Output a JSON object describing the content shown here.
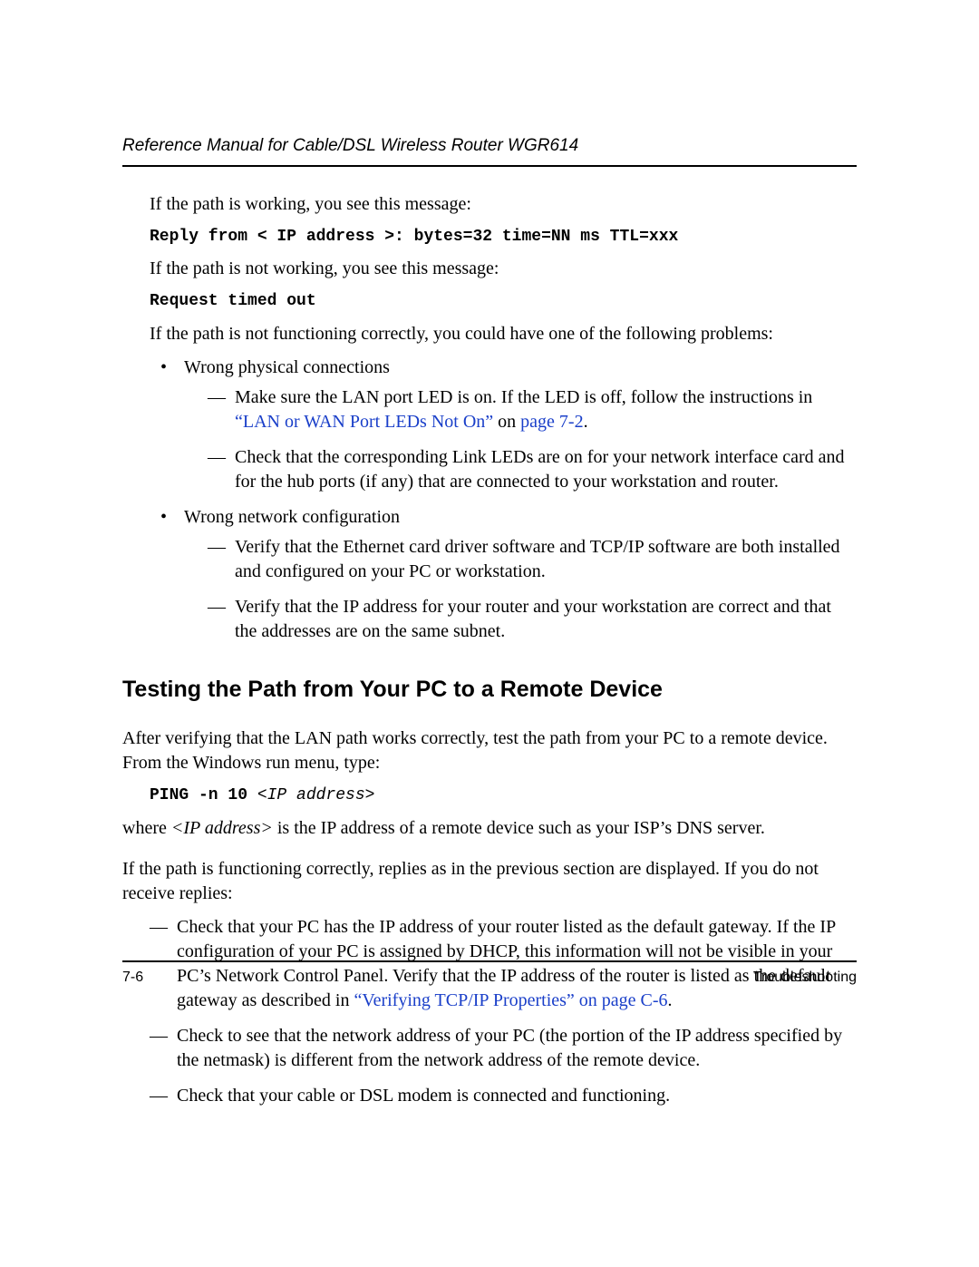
{
  "header": {
    "running_title": "Reference Manual for Cable/DSL Wireless Router WGR614"
  },
  "body": {
    "p1": "If the path is working, you see this message:",
    "code1": "Reply from < IP address >: bytes=32 time=NN ms TTL=xxx",
    "p2": "If the path is not working, you see this message:",
    "code2": "Request timed out",
    "p3": "If the path is not functioning correctly, you could have one of the following problems:",
    "b1": {
      "title": "Wrong physical connections",
      "d1_a": "Make sure the LAN port LED is on. If the LED is off, follow the instructions in ",
      "d1_link1": "“LAN or WAN Port LEDs Not On”",
      "d1_mid": " on ",
      "d1_link2": "page 7-2",
      "d1_end": ".",
      "d2": "Check that the corresponding Link LEDs are on for your network interface card and for the hub ports (if any) that are connected to your workstation and router."
    },
    "b2": {
      "title": "Wrong network configuration",
      "d1": "Verify that the Ethernet card driver software and TCP/IP software are both installed and configured on your PC or workstation.",
      "d2": "Verify that the IP address for your router and your workstation are correct and that the addresses are on the same subnet."
    },
    "h2": "Testing the Path from Your PC to a Remote Device",
    "p4": "After verifying that the LAN path works correctly, test the path from your PC to a remote device. From the Windows run menu, type:",
    "code3_cmd": "PING -n 10 ",
    "code3_arg": "<IP address>",
    "p5_a": "where ",
    "p5_i": "<IP address>",
    "p5_b": " is the IP address of a remote device such as your ISP’s DNS server.",
    "p6": "If the path is functioning correctly, replies as in the previous section are displayed. If you do not receive replies:",
    "r1_a": "Check that your PC has the IP address of your router listed as the default gateway. If the IP configuration of your PC is assigned by DHCP, this information will not be visible in your PC’s Network Control Panel. Verify that the IP address of the router is listed as the default gateway as described in ",
    "r1_link": "“Verifying TCP/IP Properties” on page C-6",
    "r1_end": ".",
    "r2": "Check to see that the network address of your PC (the portion of the IP address specified by the netmask) is different from the network address of the remote device.",
    "r3": "Check that your cable or DSL modem is connected and functioning."
  },
  "footer": {
    "page_num": "7-6",
    "section": "Troubleshooting"
  }
}
